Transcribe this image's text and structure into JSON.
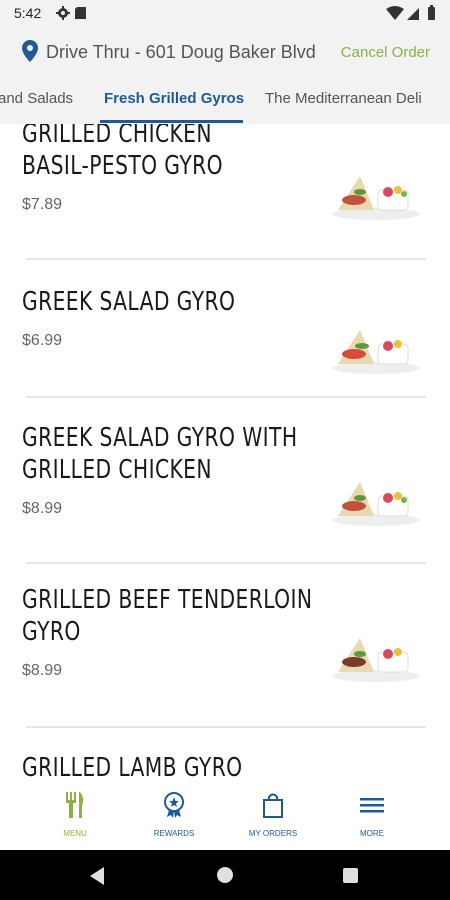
{
  "status_bar": {
    "time": "5:42"
  },
  "location": {
    "label": "Drive Thru - 601 Doug Baker Blvd",
    "cancel_label": "Cancel Order"
  },
  "tabs": [
    {
      "label": "and Salads"
    },
    {
      "label": "Fresh Grilled Gyros",
      "active": true
    },
    {
      "label": "The Mediterranean Deli"
    }
  ],
  "menu_items": [
    {
      "name_lines": [
        "GRILLED CHICKEN",
        "BASIL-PESTO GYRO"
      ],
      "price": "$7.89"
    },
    {
      "name_lines": [
        "GREEK SALAD GYRO"
      ],
      "price": "$6.99"
    },
    {
      "name_lines": [
        "GREEK SALAD GYRO WITH",
        "GRILLED CHICKEN"
      ],
      "price": "$8.99"
    },
    {
      "name_lines": [
        "GRILLED BEEF TENDERLOIN",
        "GYRO"
      ],
      "price": "$8.99"
    },
    {
      "name_lines": [
        "GRILLED LAMB GYRO"
      ],
      "price": ""
    }
  ],
  "bottom_nav": [
    {
      "label": "MENU",
      "icon": "fork-knife-icon",
      "active": true
    },
    {
      "label": "REWARDS",
      "icon": "rewards-badge-icon"
    },
    {
      "label": "MY ORDERS",
      "icon": "shopping-bag-icon"
    },
    {
      "label": "MORE",
      "icon": "hamburger-menu-icon"
    }
  ],
  "colors": {
    "accent_green": "#8ab33f",
    "brand_blue": "#1d5a96"
  }
}
